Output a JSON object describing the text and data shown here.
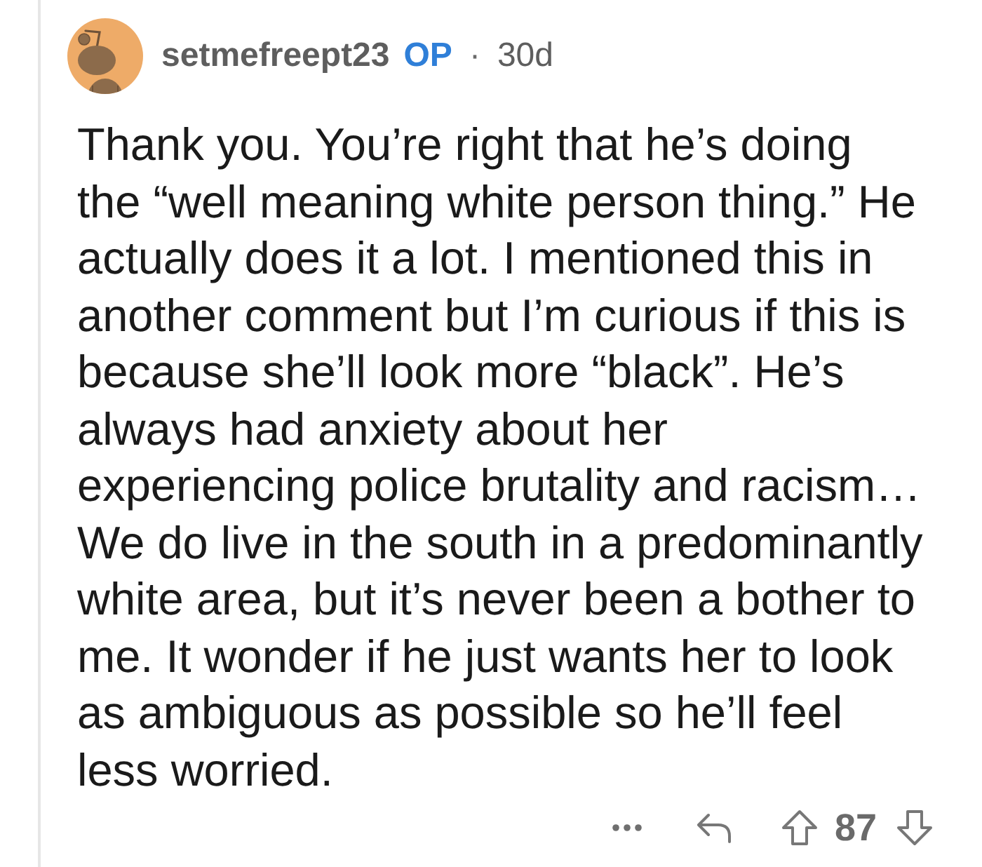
{
  "comment": {
    "author": "setmefreept23",
    "badge": "OP",
    "separator": "·",
    "age": "30d",
    "body": "Thank you. You’re right that he’s doing\nthe “well meaning white person thing.” He\nactually does it a lot. I mentioned this in\nanother comment but I’m curious if this is\nbecause she’ll look more “black”. He’s\nalways had anxiety about her\nexperiencing police brutality and racism…\nWe do live in the south in a predominantly\nwhite area, but it’s never been a bother to\nme. It wonder if he just wants her to look\nas ambiguous as possible so he’ll feel\nless worried.",
    "score": "87"
  }
}
